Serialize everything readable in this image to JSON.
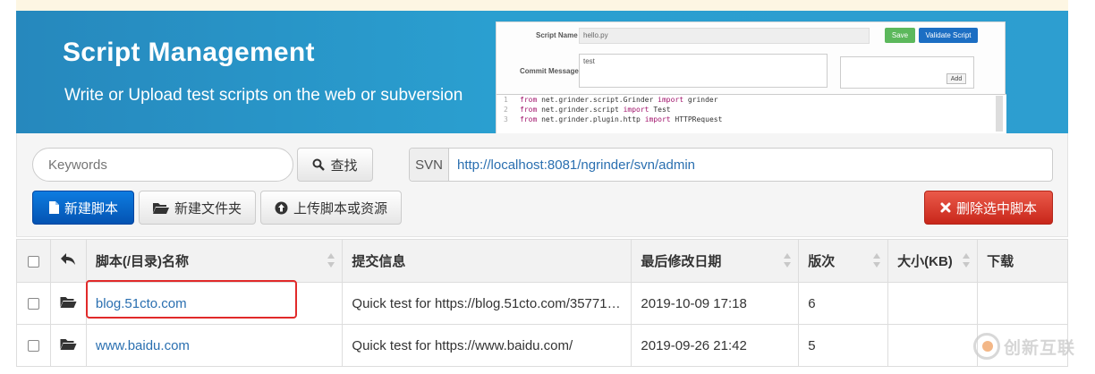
{
  "banner": {
    "title": "Script Management",
    "subtitle": "Write or Upload test scripts on the web or subversion",
    "preview": {
      "script_name_label": "Script Name",
      "script_name_value": "hello.py",
      "save_label": "Save",
      "validate_label": "Validate Script",
      "commit_label": "Commit Message",
      "commit_value": "test",
      "add_label": "Add",
      "code_lines": [
        {
          "num": "1",
          "kw1": "from",
          "mod": " net.grinder.script.Grinder ",
          "kw2": "import",
          "name": " grinder"
        },
        {
          "num": "2",
          "kw1": "from",
          "mod": " net.grinder.script ",
          "kw2": "import",
          "name": " Test"
        },
        {
          "num": "3",
          "kw1": "from",
          "mod": " net.grinder.plugin.http ",
          "kw2": "import",
          "name": " HTTPRequest"
        }
      ]
    }
  },
  "toolbar": {
    "search_placeholder": "Keywords",
    "search_label": "查找",
    "svn_label": "SVN",
    "svn_url": "http://localhost:8081/ngrinder/svn/admin",
    "new_script_label": "新建脚本",
    "new_folder_label": "新建文件夹",
    "upload_label": "上传脚本或资源",
    "delete_label": "删除选中脚本"
  },
  "table": {
    "headers": {
      "name": "脚本(/目录)名称",
      "commit": "提交信息",
      "modified": "最后修改日期",
      "revision": "版次",
      "size": "大小(KB)",
      "download": "下载"
    },
    "rows": [
      {
        "name": "blog.51cto.com",
        "commit": "Quick test for https://blog.51cto.com/35771…",
        "modified": "2019-10-09 17:18",
        "revision": "6",
        "size": "",
        "download": ""
      },
      {
        "name": "www.baidu.com",
        "commit": "Quick test for https://www.baidu.com/",
        "modified": "2019-09-26 21:42",
        "revision": "5",
        "size": "",
        "download": ""
      }
    ]
  },
  "watermark": {
    "text": "创新互联"
  },
  "colors": {
    "primary": "#0a64c8",
    "danger": "#d9382a",
    "link": "#2a6fb0",
    "highlight": "#e12a2a",
    "banner": "#2a9fd0"
  }
}
